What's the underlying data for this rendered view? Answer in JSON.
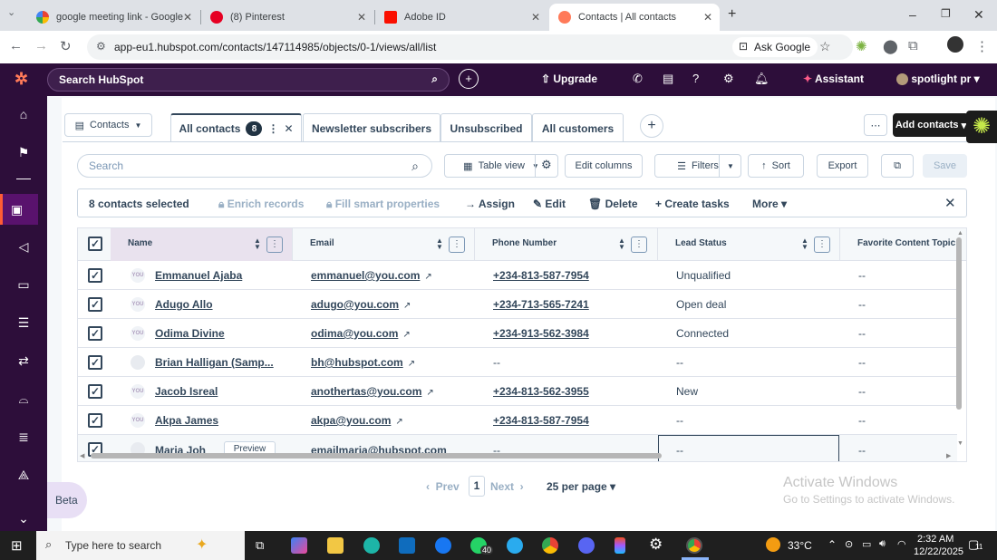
{
  "browser": {
    "tabs": [
      {
        "title": "google meeting link - Google S",
        "fav_color": "#ffffff"
      },
      {
        "title": "(8) Pinterest",
        "fav_color": "#e60023"
      },
      {
        "title": "Adobe ID",
        "fav_color": "#fa0f00"
      },
      {
        "title": "Contacts | All contacts",
        "fav_color": "#ff7a59"
      }
    ],
    "url": "app-eu1.hubspot.com/contacts/147114985/objects/0-1/views/all/list",
    "ask_google": "Ask Google"
  },
  "hubspot_nav": {
    "search_placeholder": "Search HubSpot",
    "upgrade": "Upgrade",
    "assistant": "Assistant",
    "account": "spotlight pr"
  },
  "object_selector": "Contacts",
  "views": {
    "active": "All contacts",
    "active_count": "8",
    "others": [
      "Newsletter subscribers",
      "Unsubscribed",
      "All customers"
    ]
  },
  "add_contacts": "Add contacts",
  "toolbar": {
    "search_placeholder": "Search",
    "table_view": "Table view",
    "edit_columns": "Edit columns",
    "filters": "Filters",
    "sort": "Sort",
    "export": "Export",
    "save": "Save"
  },
  "bulk": {
    "selected": "8 contacts selected",
    "enrich": "Enrich records",
    "fill": "Fill smart properties",
    "assign": "Assign",
    "edit": "Edit",
    "delete": "Delete",
    "create_tasks": "Create tasks",
    "more": "More"
  },
  "table": {
    "columns": [
      "Name",
      "Email",
      "Phone Number",
      "Lead Status",
      "Favorite Content Topic"
    ],
    "rows": [
      {
        "name": "Emmanuel Ajaba",
        "email": "emmanuel@you.com",
        "phone": "+234-813-587-7954",
        "status": "Unqualified",
        "topic": "--"
      },
      {
        "name": "Adugo Allo",
        "email": "adugo@you.com",
        "phone": "+234-713-565-7241",
        "status": "Open deal",
        "topic": "--"
      },
      {
        "name": "Odima Divine",
        "email": "odima@you.com",
        "phone": "+234-913-562-3984",
        "status": "Connected",
        "topic": "--"
      },
      {
        "name": "Brian Halligan (Samp...",
        "email": "bh@hubspot.com",
        "phone": "--",
        "status": "--",
        "topic": "--"
      },
      {
        "name": "Jacob Isreal",
        "email": "anothertas@you.com",
        "phone": "+234-813-562-3955",
        "status": "New",
        "topic": "--"
      },
      {
        "name": "Akpa James",
        "email": "akpa@you.com",
        "phone": "+234-813-587-7954",
        "status": "--",
        "topic": "--"
      },
      {
        "name": "Maria Joh",
        "email": "emailmaria@hubspot.com",
        "phone": "--",
        "status": "--",
        "topic": "--"
      }
    ],
    "preview": "Preview",
    "avatar_text": "YOU"
  },
  "pagination": {
    "prev": "Prev",
    "page": "1",
    "next": "Next",
    "per_page": "25 per page"
  },
  "beta": "Beta",
  "watermark": {
    "line1": "Activate Windows",
    "line2": "Go to Settings to activate Windows."
  },
  "taskbar": {
    "search": "Type here to search",
    "temp": "33°C",
    "time": "2:32 AM",
    "date": "12/22/2025",
    "badge": "40",
    "notif": "11"
  }
}
